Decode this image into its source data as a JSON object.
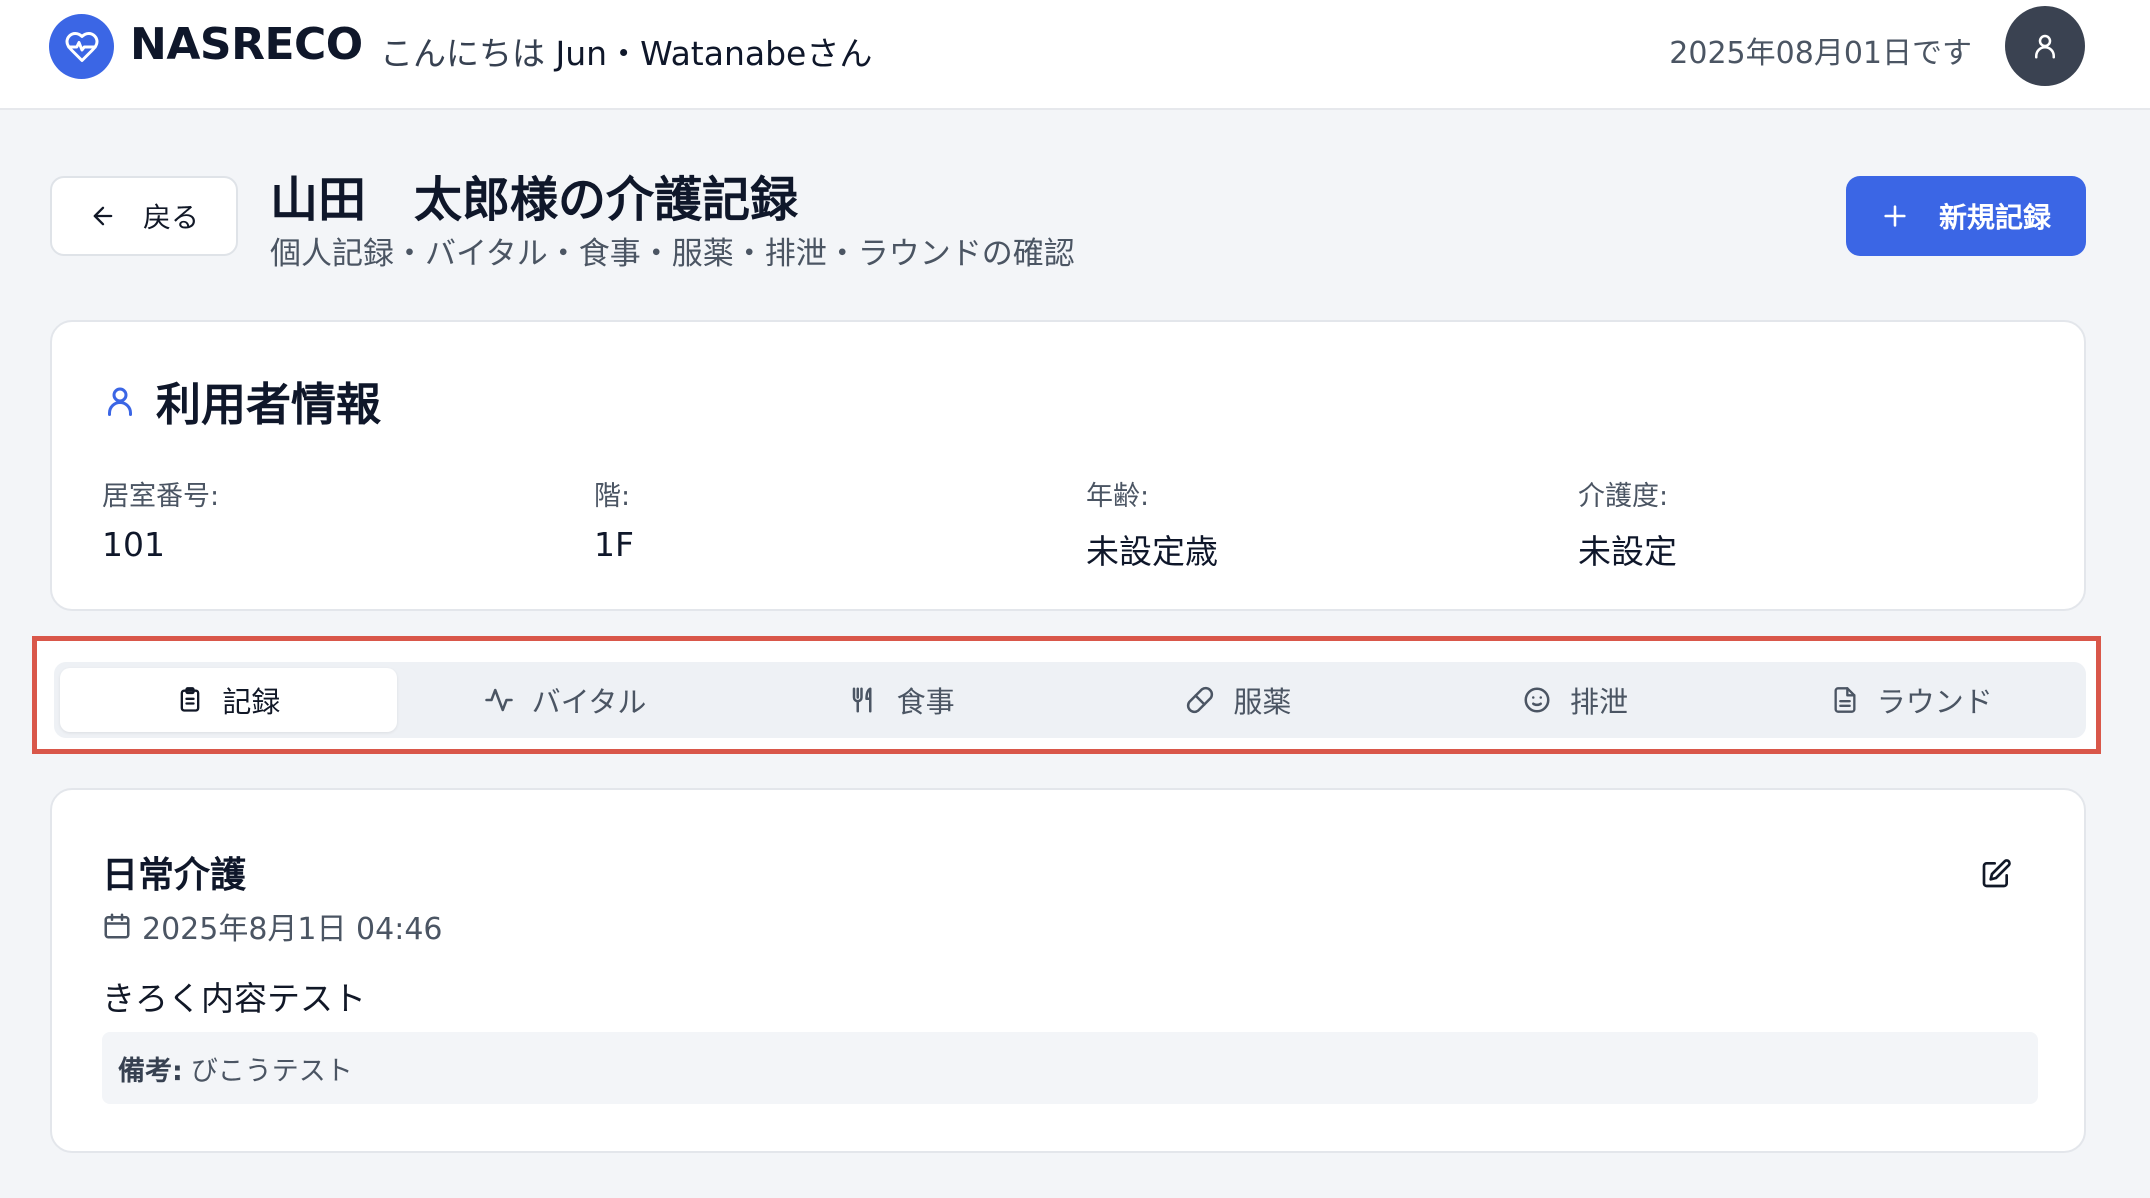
{
  "header": {
    "brand": "NASRECO",
    "greeting": "こんにちは",
    "user_name": "Jun・Watanabeさん",
    "date_text": "2025年08月01日です",
    "logo_icon": "heart-pulse-icon",
    "avatar_icon": "user-icon"
  },
  "page": {
    "back_label": "戻る",
    "title": "山田　太郎様の介護記録",
    "subtitle": "個人記録・バイタル・食事・服薬・排泄・ラウンドの確認",
    "new_record_label": "新規記録"
  },
  "user_info": {
    "title": "利用者情報",
    "fields": [
      {
        "label": "居室番号:",
        "value": "101"
      },
      {
        "label": "階:",
        "value": "1F"
      },
      {
        "label": "年齢:",
        "value": "未設定歳"
      },
      {
        "label": "介護度:",
        "value": "未設定"
      }
    ]
  },
  "tabs": [
    {
      "label": "記録",
      "icon": "clipboard-icon",
      "active": true
    },
    {
      "label": "バイタル",
      "icon": "activity-icon",
      "active": false
    },
    {
      "label": "食事",
      "icon": "utensils-icon",
      "active": false
    },
    {
      "label": "服薬",
      "icon": "pill-icon",
      "active": false
    },
    {
      "label": "排泄",
      "icon": "face-icon",
      "active": false
    },
    {
      "label": "ラウンド",
      "icon": "document-icon",
      "active": false
    }
  ],
  "record": {
    "title": "日常介護",
    "datetime": "2025年8月1日 04:46",
    "content": "きろく内容テスト",
    "note_label": "備考:",
    "note_value": "びこうテスト"
  },
  "colors": {
    "accent": "#3b66e5",
    "highlight_border": "#d9574a",
    "avatar_bg": "#3a4251",
    "page_bg": "#f3f5f8"
  }
}
